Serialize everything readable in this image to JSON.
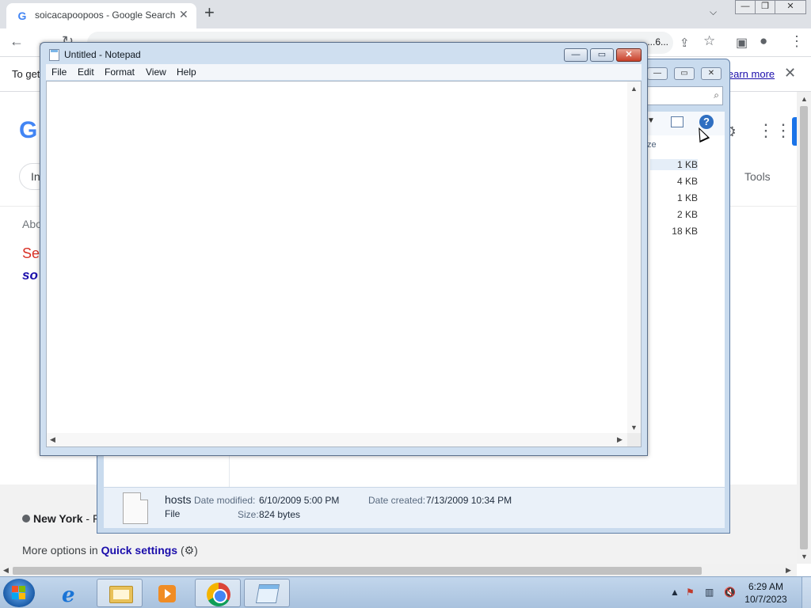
{
  "browser": {
    "tab_title": "soicacapoopoos - Google Search",
    "tab_favicon": "G",
    "url_tail": "...6...",
    "infobar_msg": "To get",
    "infobar_link": "learn more",
    "google_logo": "G",
    "chip": "In",
    "tools": "Tools",
    "about": "Abo",
    "see": "Se",
    "italic": "so",
    "location_label": "New York",
    "location_suffix": " - F",
    "more_prefix": "More options in ",
    "more_link": "Quick settings"
  },
  "explorer": {
    "col_header": "ze",
    "sizes": [
      "1 KB",
      "4 KB",
      "1 KB",
      "2 KB",
      "18 KB"
    ],
    "details": {
      "name": "hosts",
      "type": "File",
      "modified_label": "Date modified:",
      "modified_value": "6/10/2009 5:00 PM",
      "created_label": "Date created:",
      "created_value": "7/13/2009 10:34 PM",
      "size_label": "Size:",
      "size_value": "824 bytes"
    }
  },
  "notepad": {
    "title": "Untitled - Notepad",
    "menu": [
      "File",
      "Edit",
      "Format",
      "View",
      "Help"
    ],
    "content": ""
  },
  "taskbar": {
    "time": "6:29 AM",
    "date": "10/7/2023"
  }
}
